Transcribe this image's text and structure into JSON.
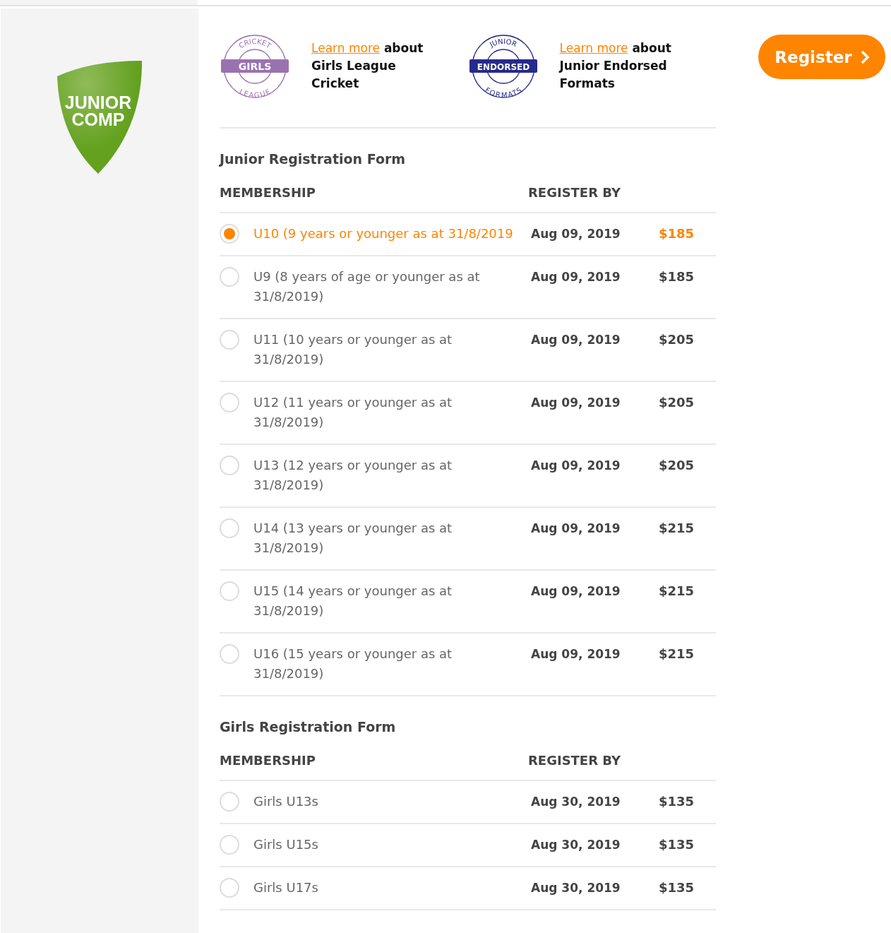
{
  "logo": {
    "line_1": "JUNIOR",
    "line_2": "COMP"
  },
  "promos": [
    {
      "badge": {
        "top": "CRICKET",
        "band": "GIRLS",
        "bottom": "LEAGUE",
        "color": "#9b72b0"
      },
      "link": "Learn more",
      "text_1": "about",
      "text_2": "Girls League Cricket"
    },
    {
      "badge": {
        "top": "JUNIOR",
        "band": "ENDORSED",
        "bottom": "FORMATS",
        "color": "#262a8c"
      },
      "link": "Learn more",
      "text_1": "about",
      "text_2": "Junior Endorsed Formats"
    }
  ],
  "register_button": {
    "label": "Register"
  },
  "forms": [
    {
      "title": "Junior Registration Form",
      "columns": [
        "MEMBERSHIP",
        "REGISTER BY"
      ],
      "rows": [
        {
          "label": "U10 (9 years or younger as at 31/8/2019",
          "date": "Aug 09, 2019",
          "price": "$185",
          "selected": true
        },
        {
          "label": "U9 (8 years of age or younger as at 31/8/2019)",
          "date": "Aug 09, 2019",
          "price": "$185",
          "selected": false
        },
        {
          "label": "U11 (10 years or younger as at 31/8/2019)",
          "date": "Aug 09, 2019",
          "price": "$205",
          "selected": false
        },
        {
          "label": "U12 (11 years or younger as at 31/8/2019)",
          "date": "Aug 09, 2019",
          "price": "$205",
          "selected": false
        },
        {
          "label": "U13 (12 years or younger as at 31/8/2019)",
          "date": "Aug 09, 2019",
          "price": "$205",
          "selected": false
        },
        {
          "label": "U14 (13 years or younger as at 31/8/2019)",
          "date": "Aug 09, 2019",
          "price": "$215",
          "selected": false
        },
        {
          "label": "U15 (14 years or younger as at 31/8/2019)",
          "date": "Aug 09, 2019",
          "price": "$215",
          "selected": false
        },
        {
          "label": "U16 (15 years or younger as at 31/8/2019)",
          "date": "Aug 09, 2019",
          "price": "$215",
          "selected": false
        }
      ]
    },
    {
      "title": "Girls Registration Form",
      "columns": [
        "MEMBERSHIP",
        "REGISTER BY"
      ],
      "rows": [
        {
          "label": "Girls U13s",
          "date": "Aug 30, 2019",
          "price": "$135",
          "selected": false
        },
        {
          "label": "Girls U15s",
          "date": "Aug 30, 2019",
          "price": "$135",
          "selected": false
        },
        {
          "label": "Girls U17s",
          "date": "Aug 30, 2019",
          "price": "$135",
          "selected": false
        }
      ]
    }
  ]
}
